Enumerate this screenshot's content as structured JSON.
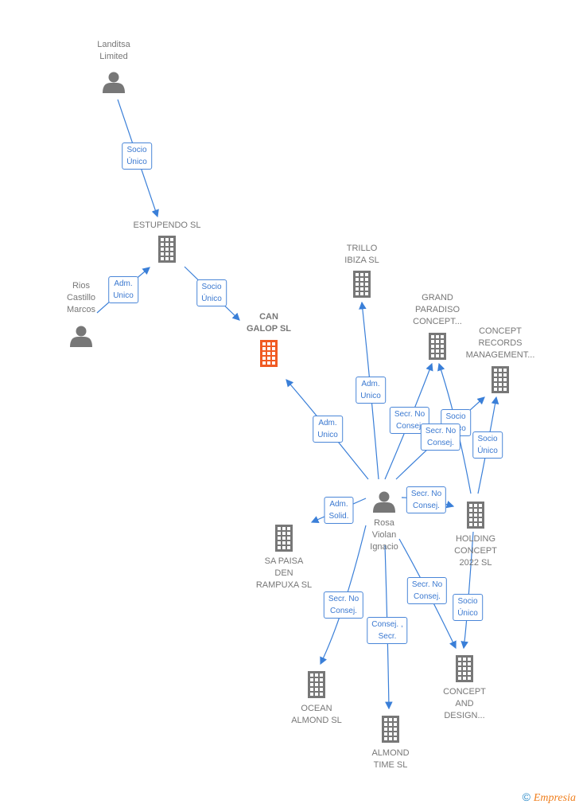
{
  "colors": {
    "edge": "#3a7fd8",
    "node": "#777777",
    "highlight": "#f05a23"
  },
  "nodes": [
    {
      "id": "landitsa",
      "type": "person",
      "lines": [
        "Landitsa",
        "Limited"
      ]
    },
    {
      "id": "estupendo",
      "type": "company",
      "lines": [
        "ESTUPENDO SL"
      ]
    },
    {
      "id": "rios",
      "type": "person",
      "lines": [
        "Rios",
        "Castillo",
        "Marcos"
      ]
    },
    {
      "id": "can_galop",
      "type": "company",
      "main": true,
      "lines": [
        "CAN",
        "GALOP  SL"
      ]
    },
    {
      "id": "trillo",
      "type": "company",
      "lines": [
        "TRILLO",
        "IBIZA  SL"
      ]
    },
    {
      "id": "grand",
      "type": "company",
      "lines": [
        "GRAND",
        "PARADISO",
        "CONCEPT..."
      ]
    },
    {
      "id": "records",
      "type": "company",
      "lines": [
        "CONCEPT",
        "RECORDS",
        "MANAGEMENT..."
      ]
    },
    {
      "id": "rosa",
      "type": "person",
      "lines": [
        "Rosa",
        "Violan",
        "Ignacio"
      ]
    },
    {
      "id": "holding",
      "type": "company",
      "lines": [
        "HOLDING",
        "CONCEPT",
        "2022  SL"
      ]
    },
    {
      "id": "sapaisa",
      "type": "company",
      "lines": [
        "SA PAISA",
        "DEN",
        "RAMPUXA SL"
      ]
    },
    {
      "id": "ocean",
      "type": "company",
      "lines": [
        "OCEAN",
        "ALMOND  SL"
      ]
    },
    {
      "id": "almondtime",
      "type": "company",
      "lines": [
        "ALMOND",
        "TIME  SL"
      ]
    },
    {
      "id": "design",
      "type": "company",
      "lines": [
        "CONCEPT",
        "AND",
        "DESIGN..."
      ]
    }
  ],
  "edges": [
    {
      "from": "landitsa",
      "to": "estupendo",
      "label": [
        "Socio",
        "Único"
      ]
    },
    {
      "from": "rios",
      "to": "estupendo",
      "label": [
        "Adm.",
        "Unico"
      ]
    },
    {
      "from": "estupendo",
      "to": "can_galop",
      "label": [
        "Socio",
        "Único"
      ]
    },
    {
      "from": "rosa",
      "to": "can_galop",
      "label": [
        "Adm.",
        "Unico"
      ]
    },
    {
      "from": "rosa",
      "to": "trillo",
      "label": [
        "Adm.",
        "Unico"
      ]
    },
    {
      "from": "rosa",
      "to": "grand",
      "label": [
        "Secr.  No",
        "Consej."
      ]
    },
    {
      "from": "holding",
      "to": "grand",
      "label": [
        "Socio",
        "Único"
      ]
    },
    {
      "from": "rosa",
      "to": "records",
      "label": [
        "Secr.  No",
        "Consej."
      ]
    },
    {
      "from": "holding",
      "to": "records",
      "label": [
        "Socio",
        "Único"
      ]
    },
    {
      "from": "rosa",
      "to": "holding",
      "label": [
        "Secr.  No",
        "Consej."
      ]
    },
    {
      "from": "rosa",
      "to": "sapaisa",
      "label": [
        "Adm.",
        "Solid."
      ]
    },
    {
      "from": "rosa",
      "to": "ocean",
      "label": [
        "Secr.  No",
        "Consej."
      ]
    },
    {
      "from": "rosa",
      "to": "almondtime",
      "label": [
        "Consej. ,",
        "Secr."
      ]
    },
    {
      "from": "rosa",
      "to": "design",
      "label": [
        "Secr.  No",
        "Consej."
      ]
    },
    {
      "from": "holding",
      "to": "design",
      "label": [
        "Socio",
        "Único"
      ]
    }
  ],
  "footer": {
    "copyright": "©",
    "brand": "Empresia"
  }
}
